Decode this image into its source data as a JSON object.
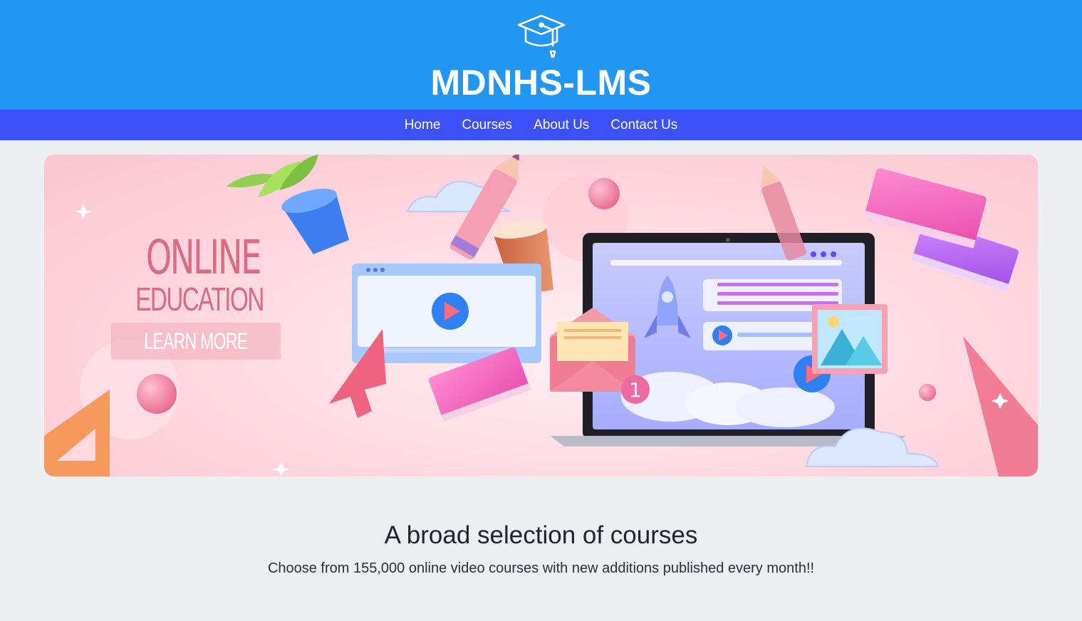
{
  "header": {
    "logo_icon": "graduation-cap-icon",
    "site_title": "MDNHS-LMS",
    "background_color": "#2196f3"
  },
  "nav": {
    "background_color": "#3d51fb",
    "items": [
      {
        "label": "Home"
      },
      {
        "label": "Courses"
      },
      {
        "label": "About Us"
      },
      {
        "label": "Contact Us"
      }
    ]
  },
  "hero": {
    "headline": "ONLINE",
    "subheadline": "EDUCATION",
    "cta_label": "LEARN MORE",
    "badge_number": "1",
    "text_color": "#d86c82"
  },
  "courses_section": {
    "title": "A broad selection of courses",
    "subtitle": "Choose from 155,000 online video courses with new additions published every month!!"
  }
}
